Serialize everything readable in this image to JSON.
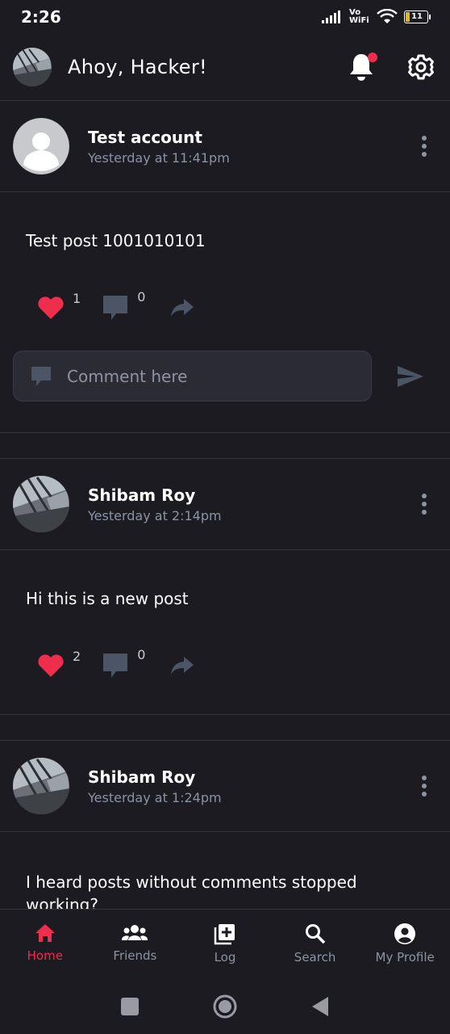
{
  "status_bar": {
    "time": "2:26",
    "vowifi": "Vo WiFi",
    "battery": "11"
  },
  "header": {
    "greeting": "Ahoy, Hacker!"
  },
  "posts": [
    {
      "author": "Test account",
      "time": "Yesterday at 11:41pm",
      "text": "Test post 1001010101",
      "likes": "1",
      "comments": "0",
      "comment_placeholder": "Comment here"
    },
    {
      "author": "Shibam Roy",
      "time": "Yesterday at 2:14pm",
      "text": "Hi this is a new post",
      "likes": "2",
      "comments": "0"
    },
    {
      "author": "Shibam Roy",
      "time": "Yesterday at 1:24pm",
      "text": "I heard posts without comments stopped working?"
    }
  ],
  "nav": {
    "items": [
      {
        "label": "Home"
      },
      {
        "label": "Friends"
      },
      {
        "label": "Log"
      },
      {
        "label": "Search"
      },
      {
        "label": "My Profile"
      }
    ]
  },
  "colors": {
    "accent": "#ef2d4d",
    "background": "#1b1b21",
    "muted": "#8d93a3"
  }
}
